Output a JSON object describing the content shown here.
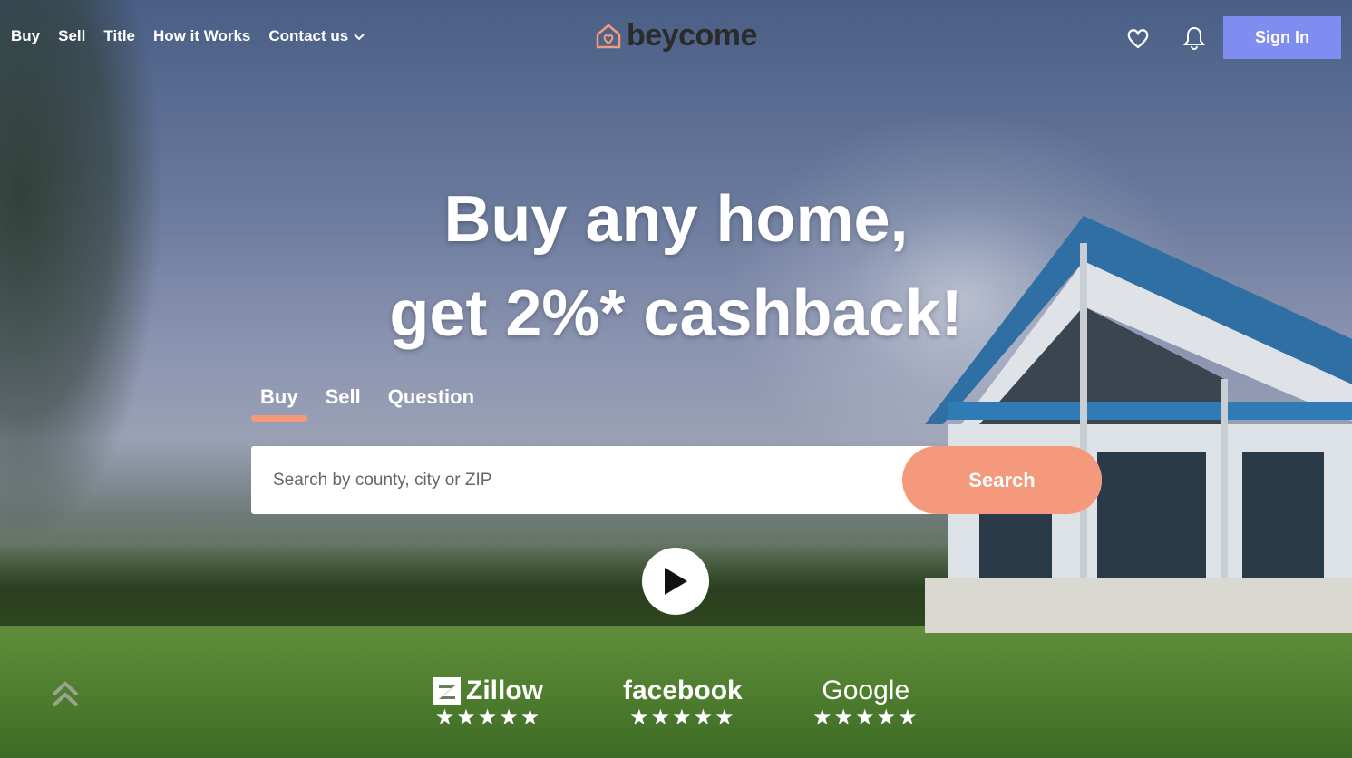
{
  "nav": {
    "links": [
      "Buy",
      "Sell",
      "Title",
      "How it Works",
      "Contact us"
    ],
    "logo_text": "beycome",
    "signin_label": "Sign In"
  },
  "hero": {
    "headline_line1": "Buy any home,",
    "headline_line2": "get 2%* cashback!"
  },
  "tabs": [
    "Buy",
    "Sell",
    "Question"
  ],
  "active_tab": "Buy",
  "search": {
    "placeholder": "Search by county, city or ZIP",
    "button_label": "Search"
  },
  "reviews": [
    {
      "name": "Zillow",
      "stars": "★★★★★"
    },
    {
      "name": "facebook",
      "stars": "★★★★★"
    },
    {
      "name": "Google",
      "stars": "★★★★★"
    }
  ],
  "colors": {
    "accent": "#f4997b",
    "signin": "#7f8cf0"
  }
}
